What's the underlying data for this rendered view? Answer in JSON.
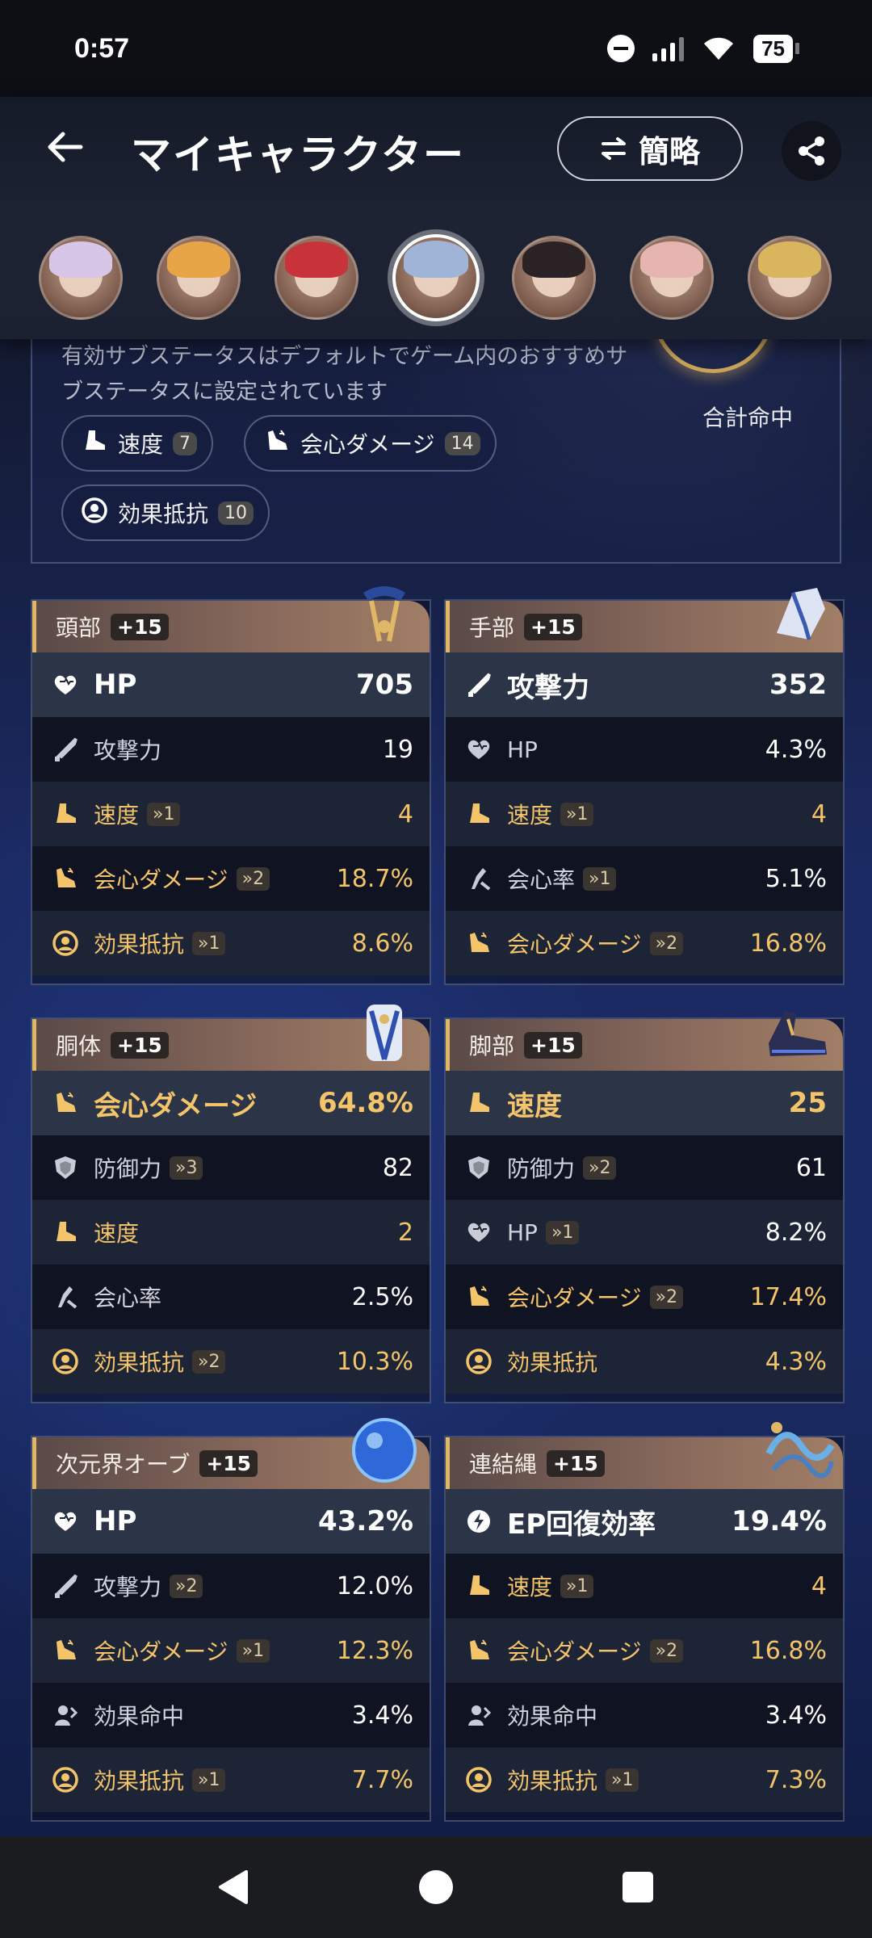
{
  "status": {
    "time": "0:57",
    "battery": "75"
  },
  "header": {
    "title": "マイキャラクター",
    "mode_label": "簡略"
  },
  "avatars": [
    {
      "name": "avatar-1",
      "hair": "#d8c6e8"
    },
    {
      "name": "avatar-2",
      "hair": "#e8a548"
    },
    {
      "name": "avatar-3",
      "hair": "#c8323a"
    },
    {
      "name": "avatar-4",
      "hair": "#9fb4d6",
      "selected": true
    },
    {
      "name": "avatar-5",
      "hair": "#2a2224"
    },
    {
      "name": "avatar-6",
      "hair": "#e7b5b0"
    },
    {
      "name": "avatar-7",
      "hair": "#d9b55e"
    }
  ],
  "summary": {
    "line1": "有効サブステータスはデフォルトでゲーム内のおすすめサ",
    "line2": "ブステータスに設定されています",
    "total_label": "合計命中",
    "chips": [
      {
        "label": "速度",
        "count": "7"
      },
      {
        "label": "会心ダメージ",
        "count": "14"
      },
      {
        "label": "効果抵抗",
        "count": "10"
      }
    ]
  },
  "cards": [
    {
      "slot": "頭部",
      "level": "+15",
      "main": {
        "stat": "HP",
        "value": "705",
        "gold": false,
        "icon": "heart"
      },
      "subs": [
        {
          "stat": "攻撃力",
          "roll": "",
          "value": "19",
          "gold": false,
          "icon": "sword"
        },
        {
          "stat": "速度",
          "roll": "1",
          "value": "4",
          "gold": true,
          "icon": "boot"
        },
        {
          "stat": "会心ダメージ",
          "roll": "2",
          "value": "18.7%",
          "gold": true,
          "icon": "crit-dmg"
        },
        {
          "stat": "効果抵抗",
          "roll": "1",
          "value": "8.6%",
          "gold": true,
          "icon": "resist"
        }
      ]
    },
    {
      "slot": "手部",
      "level": "+15",
      "main": {
        "stat": "攻撃力",
        "value": "352",
        "gold": false,
        "icon": "sword"
      },
      "subs": [
        {
          "stat": "HP",
          "roll": "",
          "value": "4.3%",
          "gold": false,
          "icon": "heart"
        },
        {
          "stat": "速度",
          "roll": "1",
          "value": "4",
          "gold": true,
          "icon": "boot"
        },
        {
          "stat": "会心率",
          "roll": "1",
          "value": "5.1%",
          "gold": false,
          "icon": "crit-rate"
        },
        {
          "stat": "会心ダメージ",
          "roll": "2",
          "value": "16.8%",
          "gold": true,
          "icon": "crit-dmg"
        }
      ]
    },
    {
      "slot": "胴体",
      "level": "+15",
      "main": {
        "stat": "会心ダメージ",
        "value": "64.8%",
        "gold": true,
        "icon": "crit-dmg"
      },
      "subs": [
        {
          "stat": "防御力",
          "roll": "3",
          "value": "82",
          "gold": false,
          "icon": "shield"
        },
        {
          "stat": "速度",
          "roll": "",
          "value": "2",
          "gold": true,
          "icon": "boot"
        },
        {
          "stat": "会心率",
          "roll": "",
          "value": "2.5%",
          "gold": false,
          "icon": "crit-rate"
        },
        {
          "stat": "効果抵抗",
          "roll": "2",
          "value": "10.3%",
          "gold": true,
          "icon": "resist"
        }
      ]
    },
    {
      "slot": "脚部",
      "level": "+15",
      "main": {
        "stat": "速度",
        "value": "25",
        "gold": true,
        "icon": "boot"
      },
      "subs": [
        {
          "stat": "防御力",
          "roll": "2",
          "value": "61",
          "gold": false,
          "icon": "shield"
        },
        {
          "stat": "HP",
          "roll": "1",
          "value": "8.2%",
          "gold": false,
          "icon": "heart"
        },
        {
          "stat": "会心ダメージ",
          "roll": "2",
          "value": "17.4%",
          "gold": true,
          "icon": "crit-dmg"
        },
        {
          "stat": "効果抵抗",
          "roll": "",
          "value": "4.3%",
          "gold": true,
          "icon": "resist"
        }
      ]
    },
    {
      "slot": "次元界オーブ",
      "level": "+15",
      "main": {
        "stat": "HP",
        "value": "43.2%",
        "gold": false,
        "icon": "heart"
      },
      "subs": [
        {
          "stat": "攻撃力",
          "roll": "2",
          "value": "12.0%",
          "gold": false,
          "icon": "sword"
        },
        {
          "stat": "会心ダメージ",
          "roll": "1",
          "value": "12.3%",
          "gold": true,
          "icon": "crit-dmg"
        },
        {
          "stat": "効果命中",
          "roll": "",
          "value": "3.4%",
          "gold": false,
          "icon": "hit"
        },
        {
          "stat": "効果抵抗",
          "roll": "1",
          "value": "7.7%",
          "gold": true,
          "icon": "resist"
        }
      ]
    },
    {
      "slot": "連結縄",
      "level": "+15",
      "main": {
        "stat": "EP回復効率",
        "value": "19.4%",
        "gold": false,
        "icon": "energy"
      },
      "subs": [
        {
          "stat": "速度",
          "roll": "1",
          "value": "4",
          "gold": true,
          "icon": "boot"
        },
        {
          "stat": "会心ダメージ",
          "roll": "2",
          "value": "16.8%",
          "gold": true,
          "icon": "crit-dmg"
        },
        {
          "stat": "効果命中",
          "roll": "",
          "value": "3.4%",
          "gold": false,
          "icon": "hit"
        },
        {
          "stat": "効果抵抗",
          "roll": "1",
          "value": "7.3%",
          "gold": true,
          "icon": "resist"
        }
      ]
    }
  ],
  "colors": {
    "gold": "#f4c46b",
    "white": "#ffffff"
  }
}
